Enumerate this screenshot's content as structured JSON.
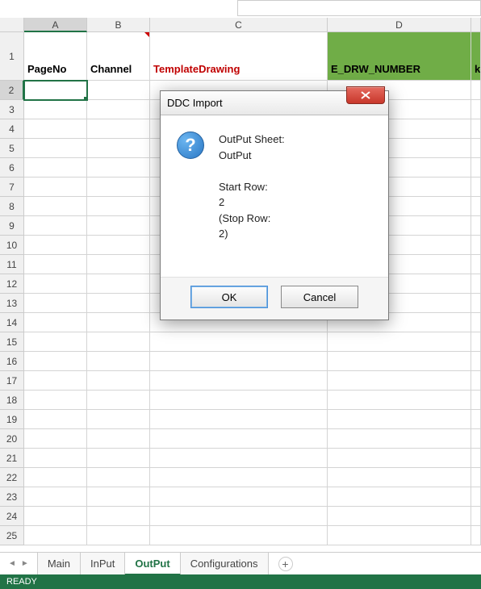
{
  "columns": [
    "A",
    "B",
    "C",
    "D",
    ""
  ],
  "activeColumn": "A",
  "activeRow": 2,
  "headerRow": {
    "A": "PageNo",
    "B": "Channel",
    "C": "TemplateDrawing",
    "D": "E_DRW_NUMBER",
    "E": "k"
  },
  "rowCount": 25,
  "dialog": {
    "title": "DDC Import",
    "body": "OutPut Sheet:\nOutPut\n\nStart Row:\n2\n(Stop Row:\n2)",
    "ok": "OK",
    "cancel": "Cancel"
  },
  "tabs": {
    "nav_back": "◄",
    "nav_fwd": "►",
    "items": [
      "Main",
      "InPut",
      "OutPut",
      "Configurations"
    ],
    "active": "OutPut"
  },
  "status": "READY",
  "icons": {
    "question": "?",
    "add": "+"
  }
}
